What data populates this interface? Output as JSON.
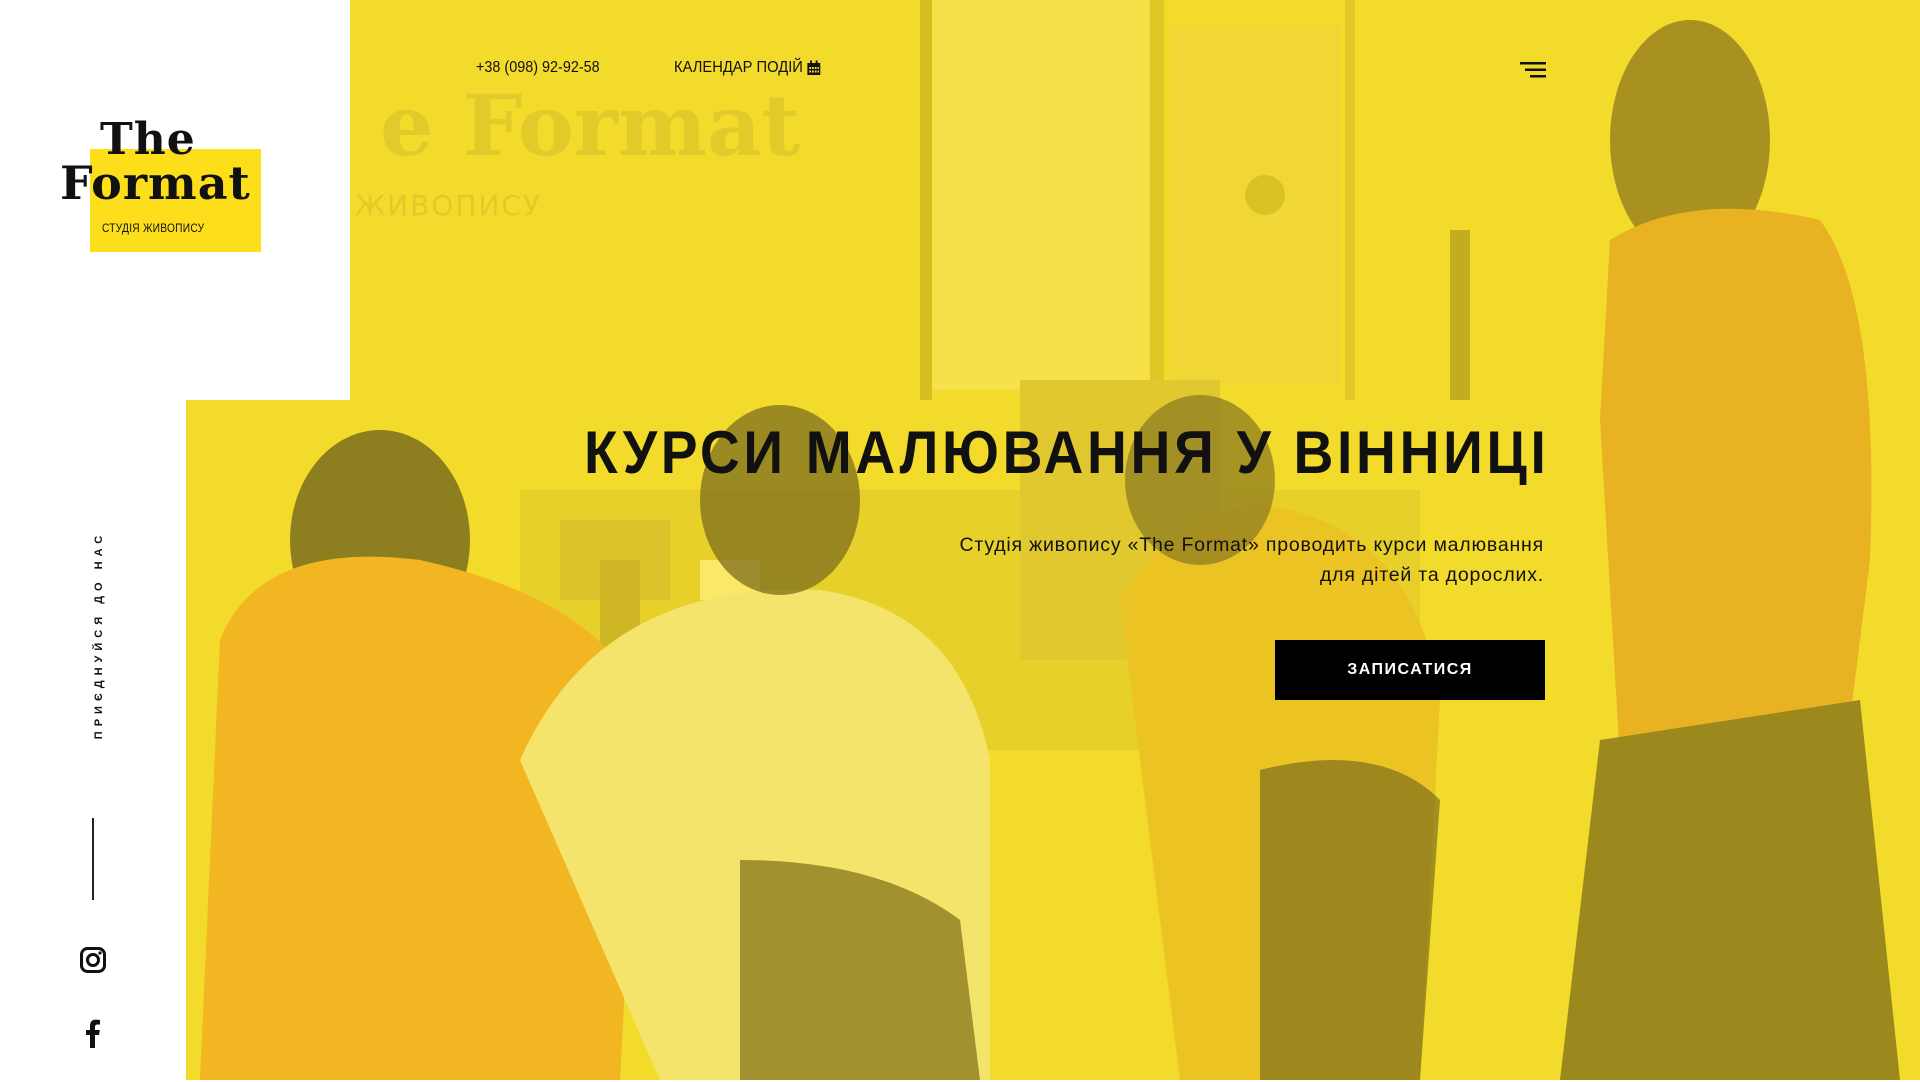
{
  "brand": {
    "logo_the": "The",
    "logo_format": "Format",
    "logo_subtitle": "СТУДІЯ ЖИВОПИСУ",
    "accent_color": "#fcdf1a"
  },
  "nav": {
    "phone": "+38 (098) 92-92-58",
    "calendar_label": "КАЛЕНДАР ПОДІЙ",
    "calendar_icon": "calendar-icon",
    "menu_icon": "hamburger-menu-icon"
  },
  "sidebar": {
    "join_text": "приєднуйся до нас",
    "socials": [
      {
        "name": "instagram",
        "icon": "instagram-icon"
      },
      {
        "name": "facebook",
        "icon": "facebook-icon"
      }
    ]
  },
  "hero": {
    "title": "КУРСИ МАЛЮВАННЯ У ВІННИЦІ",
    "description_line1": "Студія живопису «The Format» проводить курси малювання",
    "description_line2": "для дітей та дорослих.",
    "cta_label": "ЗАПИСАТИСЯ",
    "background_tint": "#f4dc2e"
  }
}
